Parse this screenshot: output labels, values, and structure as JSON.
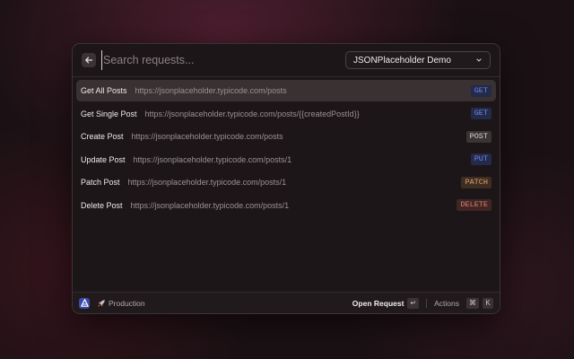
{
  "search": {
    "placeholder": "Search requests...",
    "value": ""
  },
  "collection_select": {
    "selected": "JSONPlaceholder Demo"
  },
  "requests": [
    {
      "name": "Get All Posts",
      "url": "https://jsonplaceholder.typicode.com/posts",
      "method": "GET",
      "method_color": "#6f86e8",
      "badge_bg": "#232a4a",
      "selected": true
    },
    {
      "name": "Get Single Post",
      "url": "https://jsonplaceholder.typicode.com/posts/{{createdPostId}}",
      "method": "GET",
      "method_color": "#6f86e8",
      "badge_bg": "#232a4a",
      "selected": false
    },
    {
      "name": "Create Post",
      "url": "https://jsonplaceholder.typicode.com/posts",
      "method": "POST",
      "method_color": "#d8d2d3",
      "badge_bg": "#3a3435",
      "selected": false
    },
    {
      "name": "Update Post",
      "url": "https://jsonplaceholder.typicode.com/posts/1",
      "method": "PUT",
      "method_color": "#6f86e8",
      "badge_bg": "#232a4a",
      "selected": false
    },
    {
      "name": "Patch Post",
      "url": "https://jsonplaceholder.typicode.com/posts/1",
      "method": "PATCH",
      "method_color": "#e0a56a",
      "badge_bg": "#3e2d22",
      "selected": false
    },
    {
      "name": "Delete Post",
      "url": "https://jsonplaceholder.typicode.com/posts/1",
      "method": "DELETE",
      "method_color": "#e07e6a",
      "badge_bg": "#3f2624",
      "selected": false
    }
  ],
  "footer": {
    "environment": "Production",
    "environment_icon": "rocket-icon",
    "primary_action": "Open Request",
    "primary_key": "↵",
    "actions_label": "Actions",
    "actions_keys": [
      "⌘",
      "K"
    ]
  },
  "colors": {
    "accent": "#3b4aa8",
    "background": "#1d1618"
  }
}
